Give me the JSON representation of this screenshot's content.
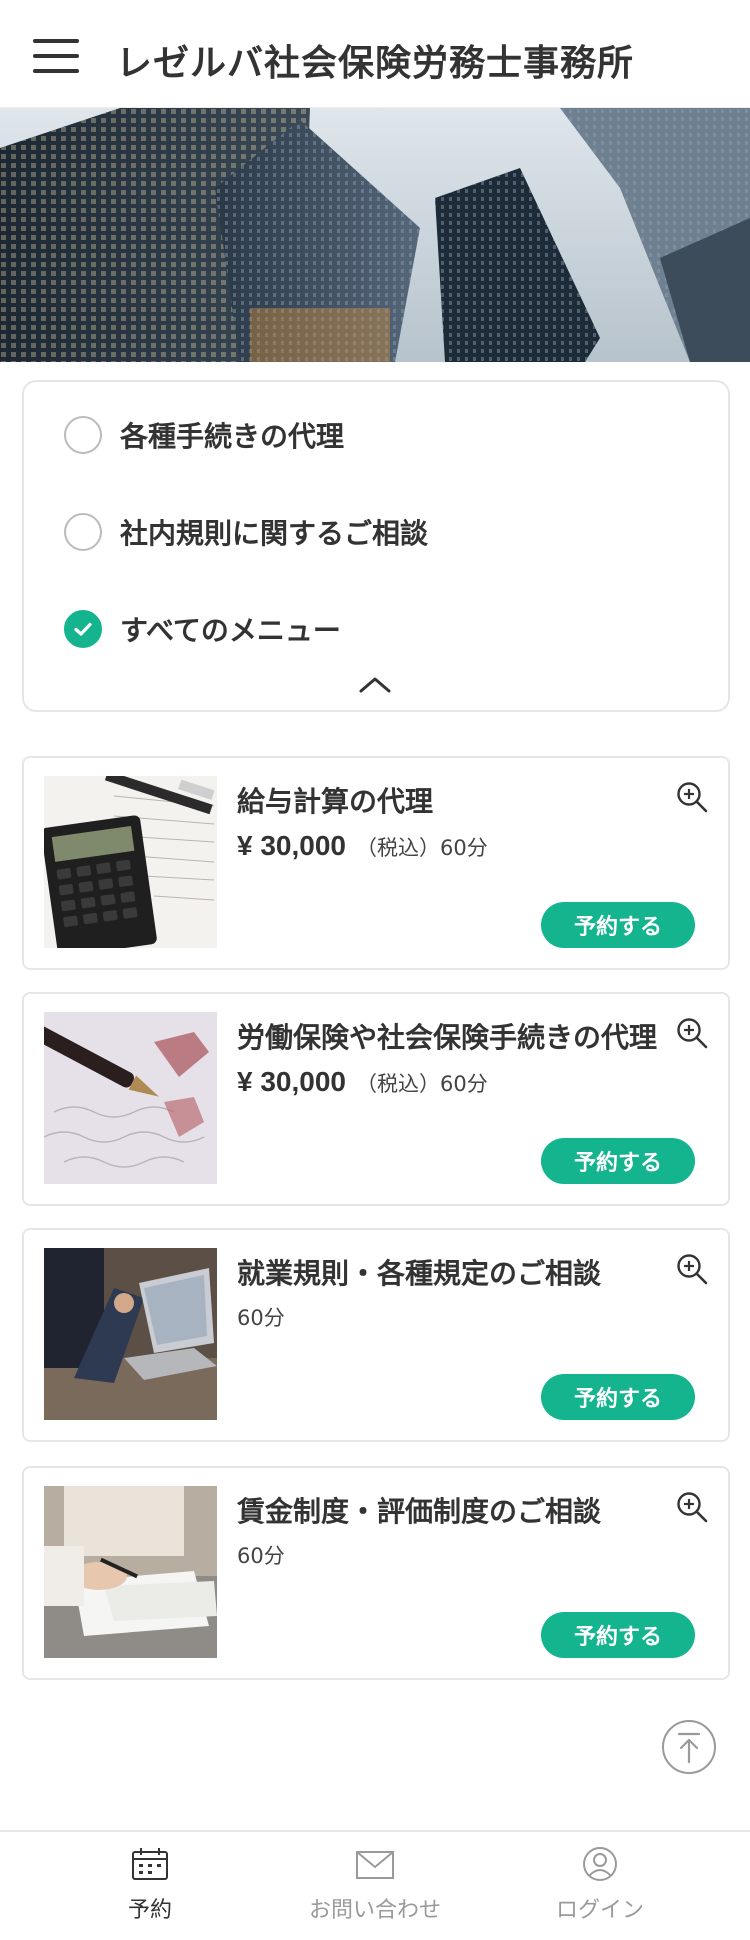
{
  "header": {
    "title": "レゼルバ社会保険労務士事務所"
  },
  "filters": [
    {
      "label": "各種手続きの代理",
      "checked": false
    },
    {
      "label": "社内規則に関するご相談",
      "checked": false
    },
    {
      "label": "すべてのメニュー",
      "checked": true
    }
  ],
  "menu_items": [
    {
      "title": "給与計算の代理",
      "price": "¥ 30,000",
      "tax": "（税込）",
      "duration": "60分",
      "button": "予約する"
    },
    {
      "title": "労働保険や社会保険手続きの代理",
      "price": "¥ 30,000",
      "tax": "（税込）",
      "duration": "60分",
      "button": "予約する"
    },
    {
      "title": "就業規則・各種規定のご相談",
      "price": "",
      "tax": "",
      "duration": "60分",
      "button": "予約する"
    },
    {
      "title": "賃金制度・評価制度のご相談",
      "price": "",
      "tax": "",
      "duration": "60分",
      "button": "予約する"
    }
  ],
  "bottom_nav": [
    {
      "label": "予約",
      "icon": "calendar-icon",
      "active": true
    },
    {
      "label": "お問い合わせ",
      "icon": "envelope-icon",
      "active": false
    },
    {
      "label": "ログイン",
      "icon": "user-icon",
      "active": false
    }
  ],
  "colors": {
    "accent": "#14b48f",
    "text": "#333333",
    "muted": "#9a9a9a",
    "border": "#e6e6e6"
  }
}
